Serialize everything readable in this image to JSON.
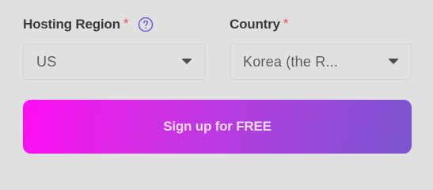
{
  "form": {
    "region": {
      "label": "Hosting Region",
      "required_mark": "*",
      "help_icon": "question-circle-icon",
      "selected_value": "US"
    },
    "country": {
      "label": "Country",
      "required_mark": "*",
      "selected_value": "Korea (the R..."
    },
    "submit_label": "Sign up for FREE"
  },
  "colors": {
    "background": "#e0e0e0",
    "label": "#3a3a3a",
    "required": "#ef4a5e",
    "help_icon": "#6b5bd6",
    "button_gradient_start": "#ff0cf4",
    "button_gradient_end": "#7a55d0",
    "button_text": "#f4dbf4"
  }
}
